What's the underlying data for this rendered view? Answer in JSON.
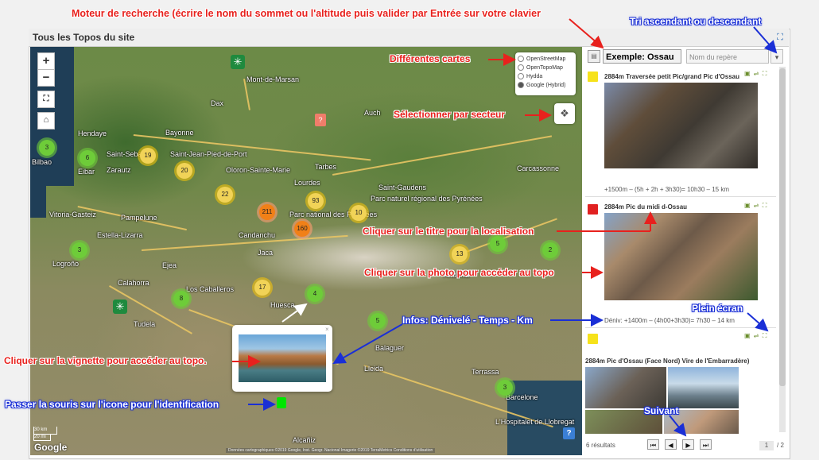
{
  "panel": {
    "title": "Tous les Topos du site"
  },
  "annotations": {
    "search_engine": "Moteur de recherche (écrire le nom du sommet ou l'altitude puis valider par Entrée sur votre clavier",
    "sort": "Tri ascendant ou descendant",
    "maps": "Différentes cartes",
    "sector": "Sélectionner par secteur",
    "title_loc": "Cliquer sur le titre pour la localisation",
    "photo_topo": "Cliquer sur la photo pour accéder au topo",
    "fullscreen": "Plein écran",
    "infos": "Infos: Dénivelé - Temps - Km",
    "thumbnail": "Cliquer sur la vignette pour accéder au topo.",
    "hover_icon": "Passer la souris sur l'icone pour l'identification",
    "next": "Suivant"
  },
  "map": {
    "layers": [
      "OpenStreetMap",
      "OpenTopoMap",
      "Hydda",
      "Google (Hybrid)"
    ],
    "selected_layer": "Google (Hybrid)",
    "cities": [
      "Mont-de-Marsan",
      "Dax",
      "Auch",
      "Bayonne",
      "Saint-Seba",
      "Bilbao",
      "Eibar",
      "Zarautz",
      "Oloron-Sainte-Marie",
      "Tarbes",
      "Lourdes",
      "Saint-Gaudens",
      "Carcassonne",
      "Vitoria-Gasteiz",
      "Pampelune",
      "Estella-Lizarra",
      "Logroño",
      "Jaca",
      "Huesca",
      "Calahorra",
      "Tudela",
      "Lleida",
      "Balaguer",
      "Barcelone",
      "Alcañiz",
      "Andorra",
      "Parc national des Pyrénées",
      "Parc naturel régional des Pyrénées",
      "Saint-Jean-Pied-de-Port",
      "Candanchu",
      "Los Caballeros",
      "Ejea",
      "Hendaye",
      "L'Hospitalet de Llobregat",
      "Terrassa"
    ],
    "clusters": [
      {
        "n": "3",
        "c": "g"
      },
      {
        "n": "6",
        "c": "g"
      },
      {
        "n": "19",
        "c": "y"
      },
      {
        "n": "20",
        "c": "y"
      },
      {
        "n": "22",
        "c": "y"
      },
      {
        "n": "93",
        "c": "y"
      },
      {
        "n": "211",
        "c": "o"
      },
      {
        "n": "160",
        "c": "o"
      },
      {
        "n": "10",
        "c": "y"
      },
      {
        "n": "5",
        "c": "g"
      },
      {
        "n": "13",
        "c": "y"
      },
      {
        "n": "2",
        "c": "g"
      },
      {
        "n": "3",
        "c": "g"
      },
      {
        "n": "17",
        "c": "y"
      },
      {
        "n": "8",
        "c": "g"
      },
      {
        "n": "4",
        "c": "g"
      },
      {
        "n": "5",
        "c": "g"
      },
      {
        "n": "3",
        "c": "g"
      }
    ],
    "scale_km": "30 km",
    "scale_mi": "20 mi",
    "logo": "Google",
    "attribution": "Données cartographiques ©2019 Google, Inst. Geogr. Nacional Imagerie ©2019 TerraMetrics   Conditions d'utilisation",
    "zoom_in": "+",
    "zoom_out": "−"
  },
  "sidebar": {
    "search_value": "Exemple: Ossau",
    "sort_placeholder": "Nom du repère",
    "items": [
      {
        "title": "2884m Traversée petit Pic/grand Pic d'Ossau",
        "info": "+1500m – (5h + 2h + 3h30)= 10h30 – 15 km",
        "marker_color": "#f6e21b"
      },
      {
        "title": "2884m Pic du midi d-Ossau",
        "info": "Déniv: +1400m – (4h00+3h30)= 7h30 – 14 km",
        "marker_color": "#e12121"
      },
      {
        "title": "2884m Pic d'Ossau (Face Nord) Vire de l'Embarradère)",
        "info": "",
        "marker_color": "#f6e21b"
      }
    ],
    "results": "6 résultats",
    "page": "1",
    "pages": "/ 2"
  },
  "colors": {
    "annotation_red": "#e8211d",
    "annotation_blue": "#1a2fd6",
    "link_blue": "#2d6db5"
  }
}
